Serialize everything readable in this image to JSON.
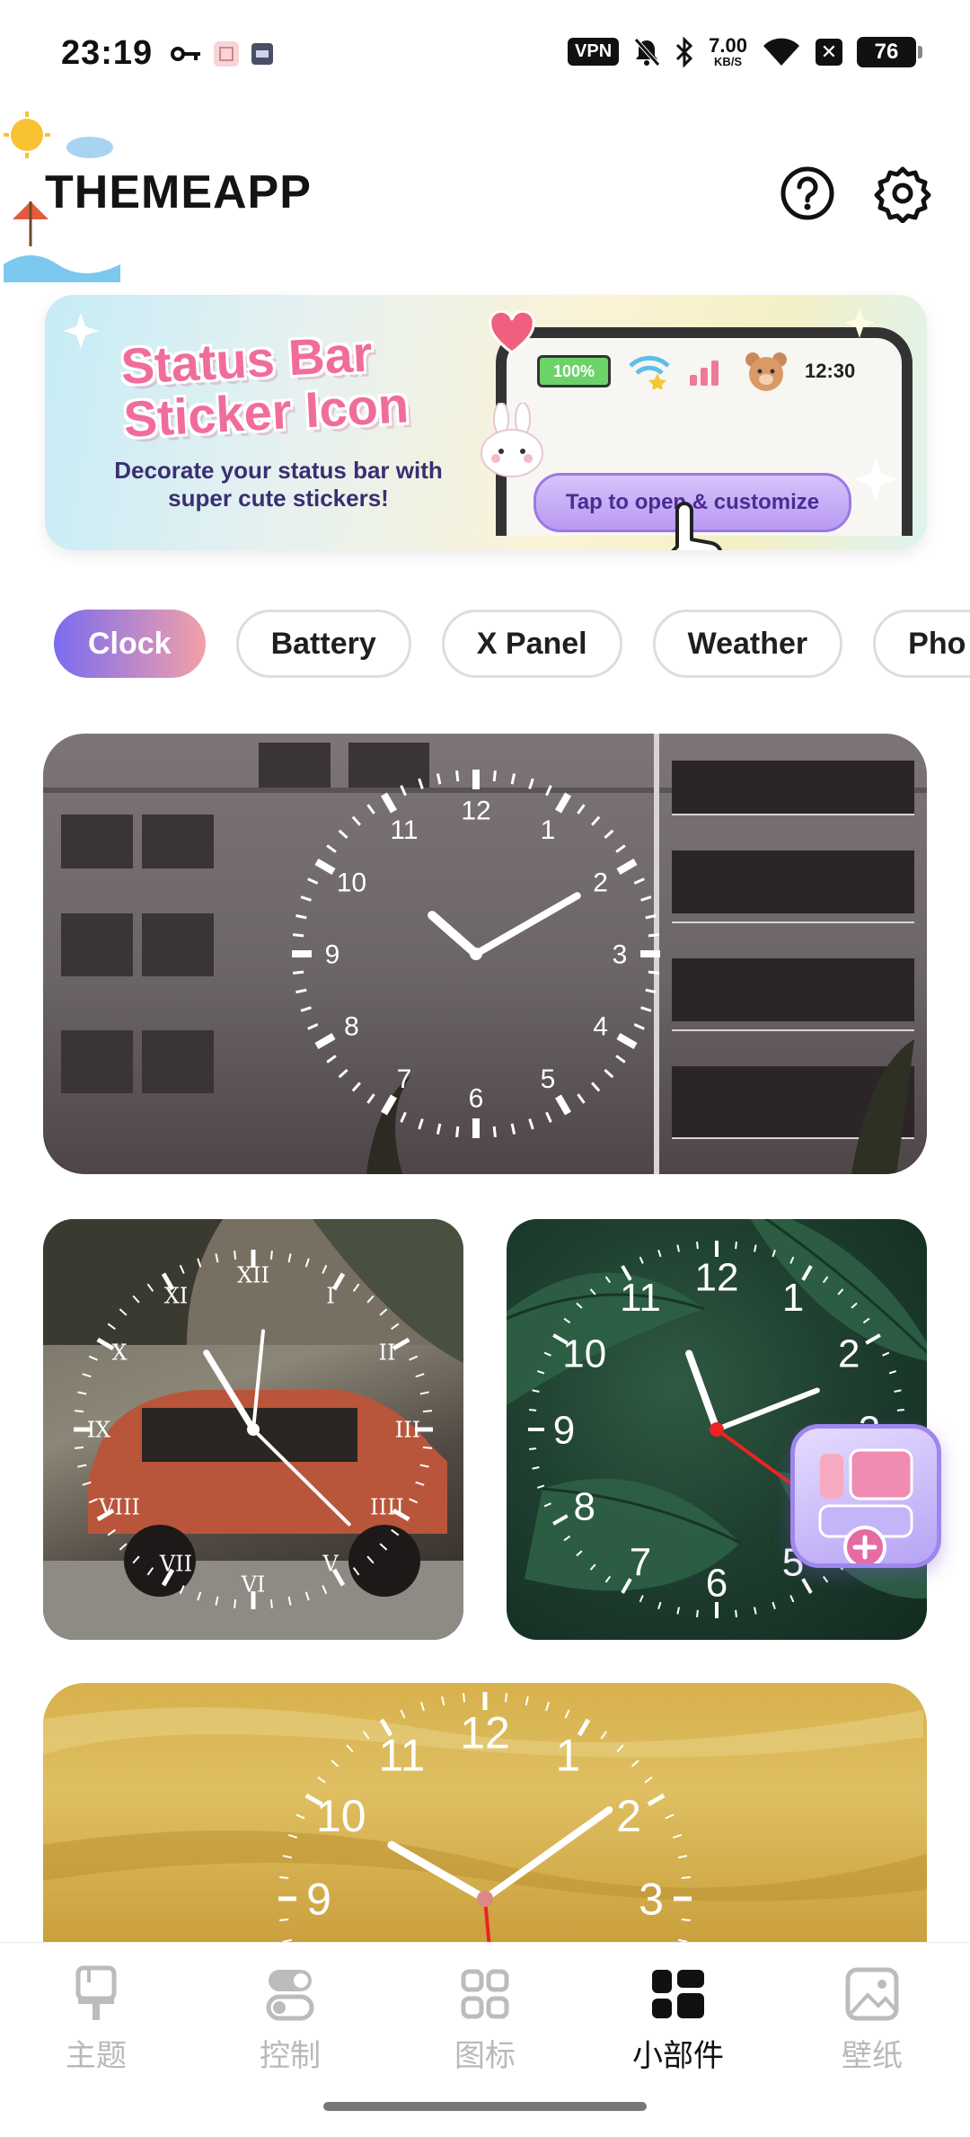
{
  "status_bar": {
    "time": "23:19",
    "vpn": "VPN",
    "speed_value": "7.00",
    "speed_unit": "KB/S",
    "battery": "76"
  },
  "header": {
    "title": "THEMEAPP",
    "help_icon": "help-circle-icon",
    "settings_icon": "gear-icon"
  },
  "banner": {
    "title": "Status Bar Sticker Icon",
    "subtitle": "Decorate your status bar with super cute stickers!",
    "mini_battery": "100%",
    "mini_time": "12:30",
    "cta": "Tap to open & customize"
  },
  "categories": [
    {
      "label": "Clock",
      "active": true
    },
    {
      "label": "Battery",
      "active": false
    },
    {
      "label": "X Panel",
      "active": false
    },
    {
      "label": "Weather",
      "active": false
    },
    {
      "label": "Pho",
      "active": false
    }
  ],
  "clock_faces": {
    "arabic": [
      "12",
      "1",
      "2",
      "3",
      "4",
      "5",
      "6",
      "7",
      "8",
      "9",
      "10",
      "11"
    ],
    "roman": [
      "XII",
      "I",
      "II",
      "III",
      "IIII",
      "V",
      "VI",
      "VII",
      "VIII",
      "IX",
      "X",
      "XI"
    ]
  },
  "nav": [
    {
      "label": "主题",
      "icon": "brush-icon",
      "active": false
    },
    {
      "label": "控制",
      "icon": "toggle-icon",
      "active": false
    },
    {
      "label": "图标",
      "icon": "grid-icon",
      "active": false
    },
    {
      "label": "小部件",
      "icon": "widgets-icon",
      "active": true
    },
    {
      "label": "壁纸",
      "icon": "wallpaper-icon",
      "active": false
    }
  ],
  "colors": {
    "accent_start": "#7a6cf0",
    "accent_end": "#f3a0a8",
    "banner_title": "#f06d9b",
    "cta": "#b99af2"
  }
}
